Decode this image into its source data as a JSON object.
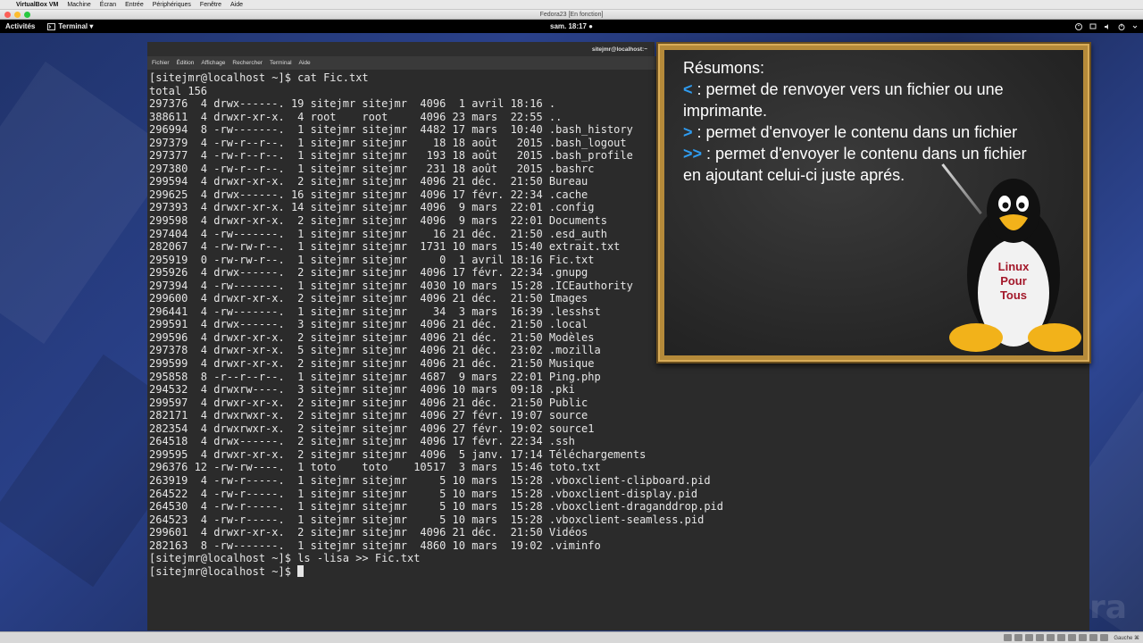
{
  "mac_menubar": {
    "items": [
      "VirtualBox VM",
      "Machine",
      "Écran",
      "Entrée",
      "Périphériques",
      "Fenêtre",
      "Aide"
    ]
  },
  "vbox": {
    "window_title": "Fedora23 [En fonction]",
    "host_key": "Gauche ⌘"
  },
  "gnome": {
    "activities": "Activités",
    "app_name": "Terminal ▾",
    "clock": "sam. 18:17 ●"
  },
  "terminal": {
    "title": "sitejmr@localhost:~",
    "menu": [
      "Fichier",
      "Édition",
      "Affichage",
      "Rechercher",
      "Terminal",
      "Aide"
    ],
    "lines": [
      "[sitejmr@localhost ~]$ cat Fic.txt",
      "total 156",
      "297376  4 drwx------. 19 sitejmr sitejmr  4096  1 avril 18:16 .",
      "388611  4 drwxr-xr-x.  4 root    root     4096 23 mars  22:55 ..",
      "296994  8 -rw-------.  1 sitejmr sitejmr  4482 17 mars  10:40 .bash_history",
      "297379  4 -rw-r--r--.  1 sitejmr sitejmr    18 18 août   2015 .bash_logout",
      "297377  4 -rw-r--r--.  1 sitejmr sitejmr   193 18 août   2015 .bash_profile",
      "297380  4 -rw-r--r--.  1 sitejmr sitejmr   231 18 août   2015 .bashrc",
      "299594  4 drwxr-xr-x.  2 sitejmr sitejmr  4096 21 déc.  21:50 Bureau",
      "299625  4 drwx------. 16 sitejmr sitejmr  4096 17 févr. 22:34 .cache",
      "297393  4 drwxr-xr-x. 14 sitejmr sitejmr  4096  9 mars  22:01 .config",
      "299598  4 drwxr-xr-x.  2 sitejmr sitejmr  4096  9 mars  22:01 Documents",
      "297404  4 -rw-------.  1 sitejmr sitejmr    16 21 déc.  21:50 .esd_auth",
      "282067  4 -rw-rw-r--.  1 sitejmr sitejmr  1731 10 mars  15:40 extrait.txt",
      "295919  0 -rw-rw-r--.  1 sitejmr sitejmr     0  1 avril 18:16 Fic.txt",
      "295926  4 drwx------.  2 sitejmr sitejmr  4096 17 févr. 22:34 .gnupg",
      "297394  4 -rw-------.  1 sitejmr sitejmr  4030 10 mars  15:28 .ICEauthority",
      "299600  4 drwxr-xr-x.  2 sitejmr sitejmr  4096 21 déc.  21:50 Images",
      "296441  4 -rw-------.  1 sitejmr sitejmr    34  3 mars  16:39 .lesshst",
      "299591  4 drwx------.  3 sitejmr sitejmr  4096 21 déc.  21:50 .local",
      "299596  4 drwxr-xr-x.  2 sitejmr sitejmr  4096 21 déc.  21:50 Modèles",
      "297378  4 drwxr-xr-x.  5 sitejmr sitejmr  4096 21 déc.  23:02 .mozilla",
      "299599  4 drwxr-xr-x.  2 sitejmr sitejmr  4096 21 déc.  21:50 Musique",
      "295858  8 -r--r--r--.  1 sitejmr sitejmr  4687  9 mars  22:01 Ping.php",
      "294532  4 drwxrw----.  3 sitejmr sitejmr  4096 10 mars  09:18 .pki",
      "299597  4 drwxr-xr-x.  2 sitejmr sitejmr  4096 21 déc.  21:50 Public",
      "282171  4 drwxrwxr-x.  2 sitejmr sitejmr  4096 27 févr. 19:07 source",
      "282354  4 drwxrwxr-x.  2 sitejmr sitejmr  4096 27 févr. 19:02 source1",
      "264518  4 drwx------.  2 sitejmr sitejmr  4096 17 févr. 22:34 .ssh",
      "299595  4 drwxr-xr-x.  2 sitejmr sitejmr  4096  5 janv. 17:14 Téléchargements",
      "296376 12 -rw-rw----.  1 toto    toto    10517  3 mars  15:46 toto.txt",
      "263919  4 -rw-r-----.  1 sitejmr sitejmr     5 10 mars  15:28 .vboxclient-clipboard.pid",
      "264522  4 -rw-r-----.  1 sitejmr sitejmr     5 10 mars  15:28 .vboxclient-display.pid",
      "264530  4 -rw-r-----.  1 sitejmr sitejmr     5 10 mars  15:28 .vboxclient-draganddrop.pid",
      "264523  4 -rw-r-----.  1 sitejmr sitejmr     5 10 mars  15:28 .vboxclient-seamless.pid",
      "299601  4 drwxr-xr-x.  2 sitejmr sitejmr  4096 21 déc.  21:50 Vidéos",
      "282163  8 -rw-------.  1 sitejmr sitejmr  4860 10 mars  19:02 .viminfo",
      "[sitejmr@localhost ~]$ ls -lisa >> Fic.txt"
    ],
    "prompt": "[sitejmr@localhost ~]$ "
  },
  "board": {
    "title": "Résumons:",
    "items": [
      {
        "symbol": "<",
        "text": " : permet de renvoyer vers un fichier ou une"
      },
      {
        "symbol": "",
        "text": "imprimante."
      },
      {
        "symbol": ">",
        "text": " : permet d'envoyer le contenu dans un fichier"
      },
      {
        "symbol": ">>",
        "text": " : permet d'envoyer le contenu dans un fichier"
      },
      {
        "symbol": "",
        "text": "en ajoutant celui-ci juste aprés."
      }
    ],
    "tux_label": [
      "Linux",
      "Pour",
      "Tous"
    ]
  },
  "desktop": {
    "watermark": "ora"
  },
  "colors": {
    "terminal_bg": "#2b2b2b",
    "terminal_fg": "#e6e6e6",
    "board_accent": "#2f9cf0",
    "board_frame": "#b58a3a"
  }
}
